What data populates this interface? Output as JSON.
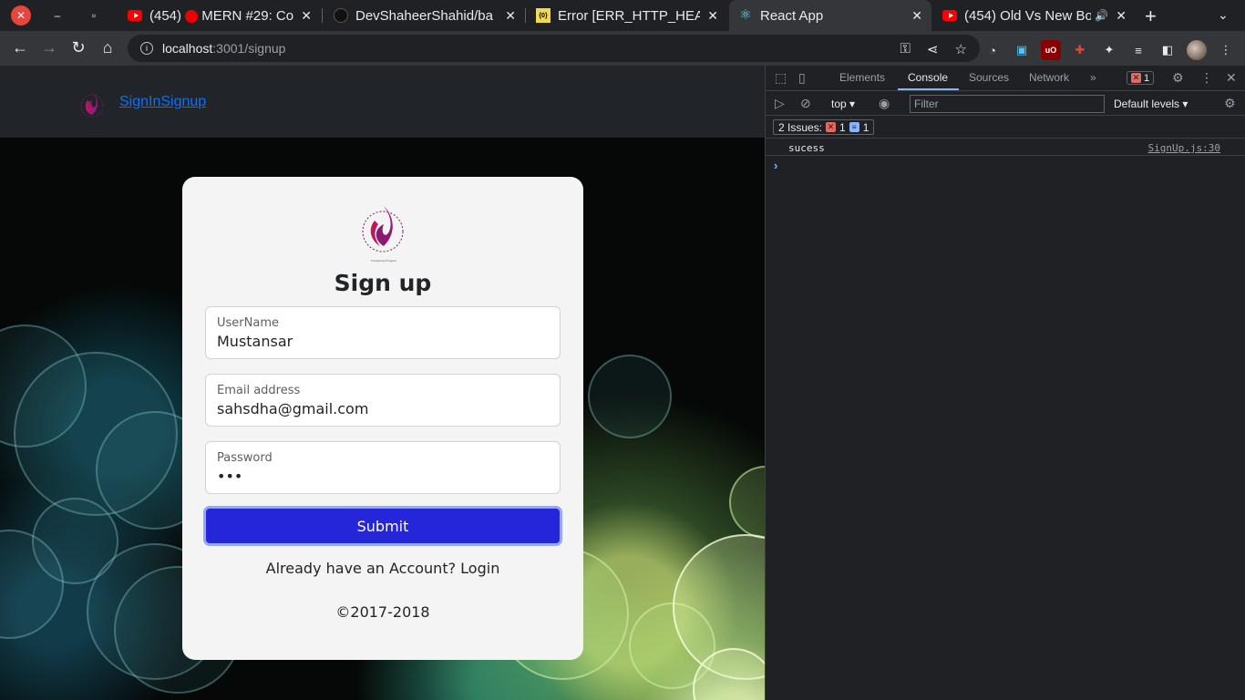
{
  "browser": {
    "tabs": [
      {
        "prefix": "(454)",
        "title": "MERN #29: Co",
        "icon": "youtube-icon"
      },
      {
        "title": "DevShaheerShahid/ba",
        "icon": "github-icon"
      },
      {
        "title": "Error [ERR_HTTP_HEAD",
        "icon": "js-icon"
      },
      {
        "title": "React App",
        "icon": "react-icon",
        "active": true
      },
      {
        "title": "(454) Old Vs New Bo",
        "icon": "youtube-icon"
      }
    ],
    "url_host": "localhost",
    "url_path": ":3001/signup"
  },
  "navbar": {
    "brand": "SignInSignup"
  },
  "form": {
    "title": "Sign up",
    "logo_caption": "Conquering Progress",
    "username_label": "UserName",
    "username_value": "Mustansar",
    "email_label": "Email address",
    "email_value": "sahsdha@gmail.com",
    "password_label": "Password",
    "password_value": "•••",
    "submit_label": "Submit",
    "account_text": "Already have an Account? Login",
    "copyright": "©2017-2018"
  },
  "devtools": {
    "tabs": [
      "Elements",
      "Console",
      "Sources",
      "Network"
    ],
    "active_tab": "Console",
    "error_count": "1",
    "context": "top",
    "filter_placeholder": "Filter",
    "levels": "Default levels",
    "issues_label": "2 Issues:",
    "issues_errors": "1",
    "issues_info": "1",
    "log_message": "sucess",
    "log_source": "SignUp.js:30"
  },
  "colors": {
    "accent": "#2525d9",
    "link": "#0d6efd",
    "devtools_active": "#8ab4f8"
  }
}
